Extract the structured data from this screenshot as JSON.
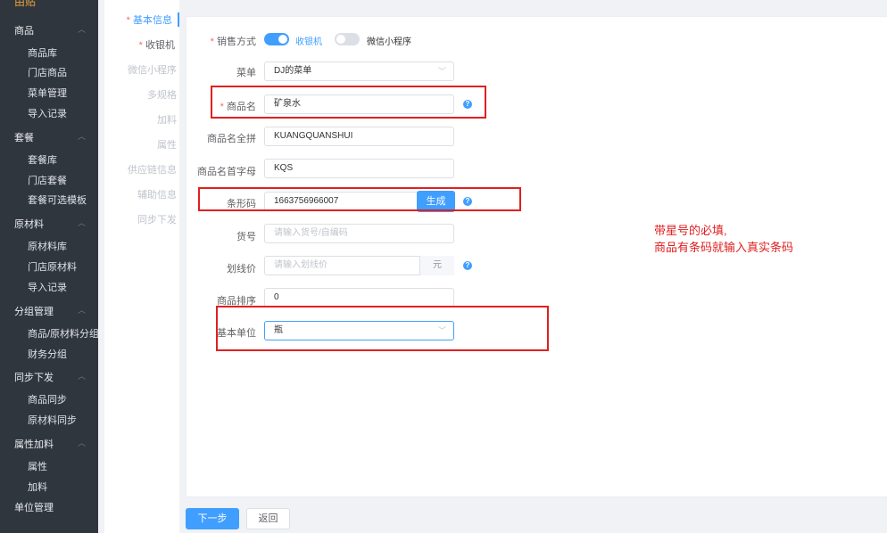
{
  "sidebar": {
    "top_label": "由贴",
    "groups": [
      {
        "label": "商品",
        "items": [
          "商品库",
          "门店商品",
          "菜单管理",
          "导入记录"
        ]
      },
      {
        "label": "套餐",
        "items": [
          "套餐库",
          "门店套餐",
          "套餐可选模板"
        ]
      },
      {
        "label": "原材料",
        "items": [
          "原材料库",
          "门店原材料",
          "导入记录"
        ]
      },
      {
        "label": "分组管理",
        "items": [
          "商品/原材料分组",
          "财务分组"
        ]
      },
      {
        "label": "同步下发",
        "items": [
          "商品同步",
          "原材料同步"
        ]
      },
      {
        "label": "属性加料",
        "items": [
          "属性",
          "加料"
        ]
      },
      {
        "label": "单位管理",
        "items": []
      }
    ]
  },
  "steps": [
    "基本信息",
    "收银机",
    "微信小程序",
    "多规格",
    "加料",
    "属性",
    "供应链信息",
    "辅助信息",
    "同步下发"
  ],
  "form": {
    "sale_mode_label": "销售方式",
    "sale_mode_options": [
      "收银机",
      "微信小程序"
    ],
    "menu_label": "菜单",
    "menu_value": "DJ的菜单",
    "name_label": "商品名",
    "name_value": "矿泉水",
    "pinyin_label": "商品名全拼",
    "pinyin_value": "KUANGQUANSHUI",
    "initials_label": "商品名首字母",
    "initials_value": "KQS",
    "barcode_label": "条形码",
    "barcode_value": "1663756966007",
    "barcode_btn": "生成",
    "sku_label": "货号",
    "sku_placeholder": "请输入货号/自编码",
    "price_label": "划线价",
    "price_placeholder": "请输入划线价",
    "price_unit": "元",
    "sort_label": "商品排序",
    "sort_value": "0",
    "unit_label": "基本单位",
    "unit_value": "瓶"
  },
  "annotation": {
    "line1": "带星号的必填,",
    "line2": "商品有条码就输入真实条码"
  },
  "footer": {
    "next_label": "下一步",
    "back_label": "返回"
  },
  "colors": {
    "accent": "#409eff",
    "annotation_red": "#e02020",
    "sidebar_bg": "#30363e"
  },
  "icons": [
    "chevron-up-icon",
    "help-icon",
    "chevron-down-icon"
  ]
}
